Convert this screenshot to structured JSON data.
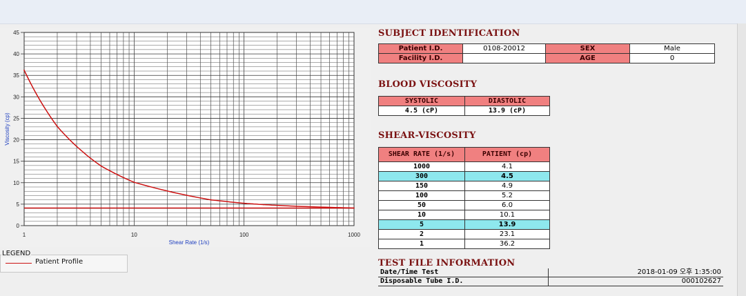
{
  "subject": {
    "title": "SUBJECT IDENTIFICATION",
    "patient_id_label": "Patient I.D.",
    "patient_id_value": "0108-20012",
    "sex_label": "SEX",
    "sex_value": "Male",
    "facility_id_label": "Facility I.D.",
    "facility_id_value": "",
    "age_label": "AGE",
    "age_value": "0"
  },
  "blood": {
    "title": "BLOOD VISCOSITY",
    "systolic_label": "SYSTOLIC",
    "diastolic_label": "DIASTOLIC",
    "systolic_value": "4.5 (cP)",
    "diastolic_value": "13.9 (cP)"
  },
  "shear": {
    "title": "SHEAR-VISCOSITY",
    "col_rate": "SHEAR RATE (1/s)",
    "col_patient": "PATIENT (cp)",
    "rows": [
      {
        "rate": "1000",
        "value": "4.1"
      },
      {
        "rate": "300",
        "value": "4.5"
      },
      {
        "rate": "150",
        "value": "4.9"
      },
      {
        "rate": "100",
        "value": "5.2"
      },
      {
        "rate": "50",
        "value": "6.0"
      },
      {
        "rate": "10",
        "value": "10.1"
      },
      {
        "rate": "5",
        "value": "13.9"
      },
      {
        "rate": "2",
        "value": "23.1"
      },
      {
        "rate": "1",
        "value": "36.2"
      }
    ]
  },
  "test_file": {
    "title": "TEST FILE INFORMATION",
    "date_label": "Date/Time Test",
    "date_value": "2018-01-09  오후 1:35:00",
    "tube_label": "Disposable Tube I.D.",
    "tube_value": "000102627"
  },
  "legend": {
    "title": "LEGEND",
    "entry": "Patient Profile"
  },
  "colors": {
    "header_red": "#f08080",
    "highlight_cyan": "#8ee8ee",
    "title_maroon": "#7a1111",
    "curve_red": "#cc1111"
  },
  "chart_data": {
    "type": "line",
    "xlabel": "Shear Rate (1/s)",
    "ylabel": "Viscosity (cp)",
    "x_scale": "log",
    "xlim": [
      1,
      1000
    ],
    "ylim": [
      0,
      45
    ],
    "x_ticks": [
      "1",
      "10",
      "100",
      "1000"
    ],
    "y_ticks": [
      "0",
      "5",
      "10",
      "15",
      "20",
      "25",
      "30",
      "35",
      "40",
      "45"
    ],
    "grid": true,
    "series": [
      {
        "name": "Patient Profile",
        "x": [
          1,
          2,
          5,
          10,
          50,
          100,
          150,
          300,
          1000
        ],
        "y": [
          36.2,
          23.1,
          13.9,
          10.1,
          6.0,
          5.2,
          4.9,
          4.5,
          4.1
        ]
      }
    ],
    "reference_line_y": 4.1
  }
}
